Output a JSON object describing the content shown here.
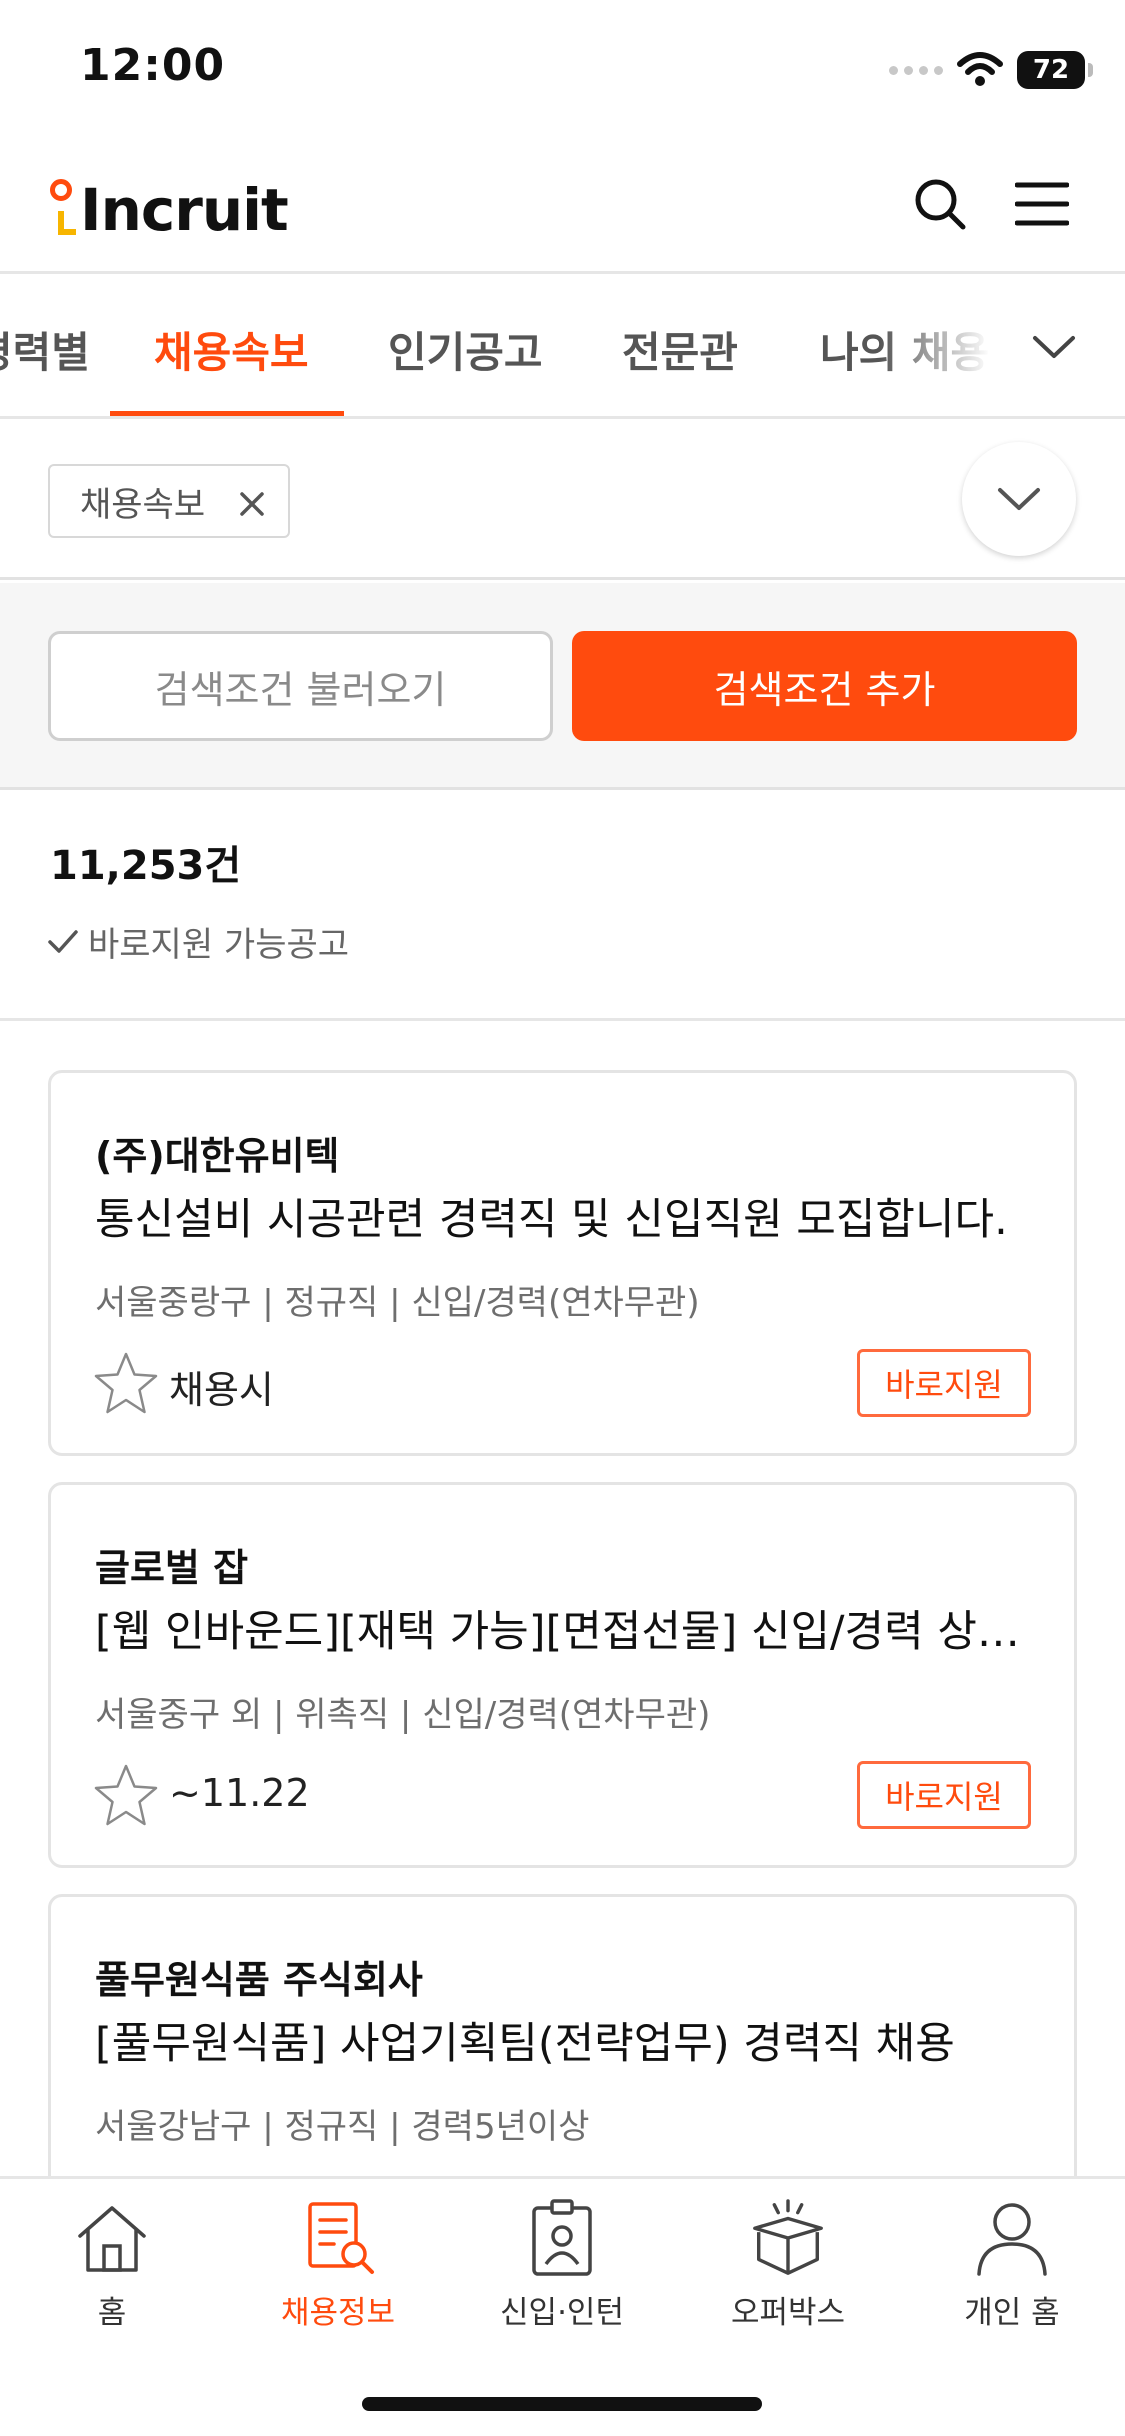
{
  "status_bar": {
    "time": "12:00",
    "battery": "72"
  },
  "header": {
    "logo_text": "Incruit"
  },
  "category_tabs": [
    {
      "label": "경력별",
      "active": false
    },
    {
      "label": "채용속보",
      "active": true
    },
    {
      "label": "인기공고",
      "active": false
    },
    {
      "label": "전문관",
      "active": false
    },
    {
      "label": "나의 채용정",
      "active": false
    }
  ],
  "filter": {
    "chip_label": "채용속보"
  },
  "search_conditions": {
    "load_label": "검색조건 불러오기",
    "add_label": "검색조건 추가"
  },
  "results": {
    "count": "11,253건",
    "direct_apply_label": "바로지원 가능공고"
  },
  "jobs": [
    {
      "company": "(주)대한유비텍",
      "title": "통신설비 시공관련 경력직 및 신입직원 모집합니다.",
      "meta": "서울중랑구 | 정규직 | 신입/경력(연차무관)",
      "deadline": "채용시",
      "apply_label": "바로지원"
    },
    {
      "company": "글로벌 잡",
      "title": "[웹 인바운드][재택 가능][면접선물] 신입/경력 상담직 모집",
      "meta": "서울중구 외 | 위촉직 | 신입/경력(연차무관)",
      "deadline": "~11.22",
      "apply_label": "바로지원"
    },
    {
      "company": "풀무원식품 주식회사",
      "title": "[풀무원식품] 사업기획팀(전략업무) 경력직 채용",
      "meta": "서울강남구 | 정규직 | 경력5년이상",
      "deadline": "",
      "apply_label": ""
    }
  ],
  "bottom_nav": [
    {
      "label": "홈",
      "icon": "home-icon",
      "active": false
    },
    {
      "label": "채용정보",
      "icon": "job-search-document-icon",
      "active": true
    },
    {
      "label": "신입·인턴",
      "icon": "id-badge-icon",
      "active": false
    },
    {
      "label": "오퍼박스",
      "icon": "open-box-icon",
      "active": false
    },
    {
      "label": "개인 홈",
      "icon": "person-icon",
      "active": false
    }
  ],
  "colors": {
    "accent": "#ff4b0e",
    "logo_yellow": "#f7b500",
    "border": "#e4e4e4"
  }
}
